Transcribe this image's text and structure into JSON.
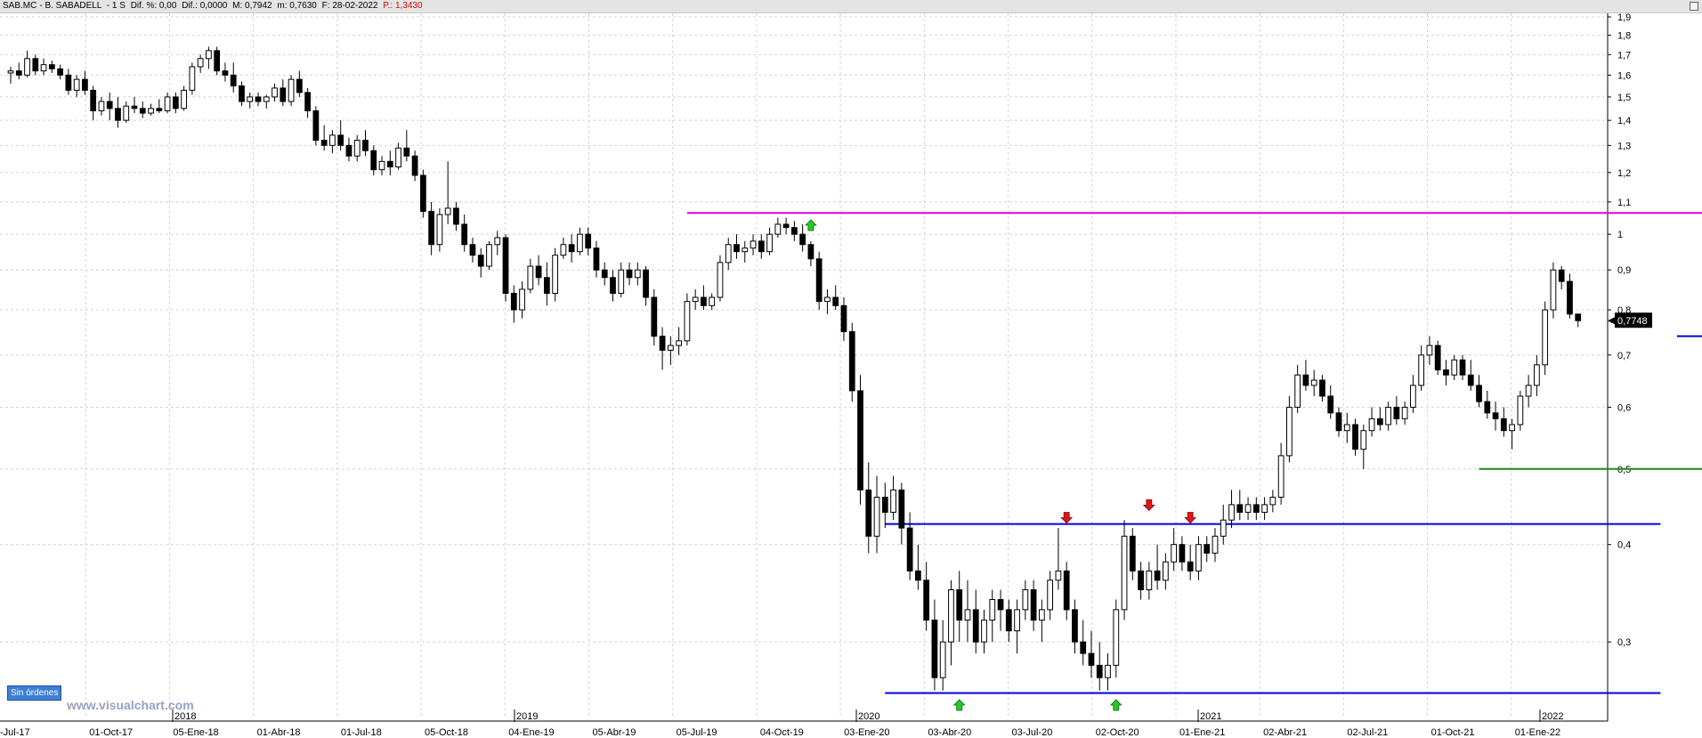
{
  "header": {
    "symbol": "SAB.MC",
    "name": "- B. SABADELL",
    "timeframe": "- 1 S",
    "dif_pct": "Dif. %: 0,00",
    "dif": "Dif.: 0,0000",
    "max": "M: 0,7942",
    "min": "m: 0,7630",
    "date": "F: 28-02-2022",
    "price": "P.: 1,3430"
  },
  "status": {
    "orders_label": "Sin órdenes"
  },
  "watermark": "www.visualchart.com",
  "colors": {
    "magenta_line": "#e000e0",
    "blue_line": "#0000e6",
    "green_line": "#1a8a1a",
    "up_arrow": "#22cc22",
    "down_arrow": "#e01515",
    "candle": "#000000",
    "grid": "#d4d4d4"
  },
  "chart_data": {
    "type": "candlestick",
    "scale": "log",
    "ylim": [
      0.24,
      1.9
    ],
    "grid": true,
    "y_ticks": [
      "1,9",
      "1,8",
      "1,7",
      "1,6",
      "1,5",
      "1,4",
      "1,3",
      "1,2",
      "1,1",
      "1",
      "0,9",
      "0,8",
      "0,7",
      "0,6",
      "0,5",
      "0,4",
      "0,3"
    ],
    "x_ticks": [
      "-Jul-17",
      "01-Oct-17",
      "05-Ene-18",
      "01-Abr-18",
      "01-Jul-18",
      "05-Oct-18",
      "04-Ene-19",
      "05-Abr-19",
      "05-Jul-19",
      "04-Oct-19",
      "03-Ene-20",
      "03-Abr-20",
      "03-Jul-20",
      "02-Oct-20",
      "01-Ene-21",
      "02-Abr-21",
      "02-Jul-21",
      "01-Oct-21",
      "01-Ene-22"
    ],
    "year_labels": [
      "2018",
      "2019",
      "2020",
      "2021",
      "2022"
    ],
    "last_price_label": "0,7748",
    "horizontal_lines": [
      {
        "color": "magenta_line",
        "value": 1.065,
        "from": 82,
        "to": 236
      },
      {
        "color": "blue_line",
        "value": 0.425,
        "from": 106,
        "to": 200
      },
      {
        "color": "blue_line",
        "value": 0.258,
        "from": 106,
        "to": 200
      },
      {
        "color": "green_line",
        "value": 0.5,
        "from": 178,
        "to": 218
      },
      {
        "color": "blue_line",
        "value": 0.74,
        "from": 202,
        "to": 240
      }
    ],
    "arrows": [
      {
        "type": "up",
        "index": 97,
        "value": 1.06
      },
      {
        "type": "down",
        "index": 128,
        "value": 0.424
      },
      {
        "type": "down",
        "index": 138,
        "value": 0.44
      },
      {
        "type": "down",
        "index": 143,
        "value": 0.424
      },
      {
        "type": "up",
        "index": 115,
        "value": 0.257
      },
      {
        "type": "up",
        "index": 134,
        "value": 0.257
      }
    ],
    "candles": [
      [
        1.61,
        1.64,
        1.56,
        1.62
      ],
      [
        1.62,
        1.66,
        1.58,
        1.6
      ],
      [
        1.6,
        1.72,
        1.59,
        1.68
      ],
      [
        1.68,
        1.7,
        1.6,
        1.62
      ],
      [
        1.62,
        1.68,
        1.6,
        1.65
      ],
      [
        1.65,
        1.67,
        1.61,
        1.63
      ],
      [
        1.63,
        1.65,
        1.58,
        1.6
      ],
      [
        1.6,
        1.63,
        1.51,
        1.53
      ],
      [
        1.53,
        1.6,
        1.5,
        1.58
      ],
      [
        1.58,
        1.62,
        1.51,
        1.53
      ],
      [
        1.53,
        1.55,
        1.4,
        1.44
      ],
      [
        1.44,
        1.5,
        1.42,
        1.48
      ],
      [
        1.48,
        1.52,
        1.4,
        1.45
      ],
      [
        1.45,
        1.5,
        1.37,
        1.4
      ],
      [
        1.4,
        1.48,
        1.39,
        1.46
      ],
      [
        1.46,
        1.5,
        1.43,
        1.45
      ],
      [
        1.45,
        1.48,
        1.41,
        1.43
      ],
      [
        1.43,
        1.47,
        1.42,
        1.45
      ],
      [
        1.45,
        1.49,
        1.43,
        1.44
      ],
      [
        1.44,
        1.52,
        1.43,
        1.5
      ],
      [
        1.5,
        1.52,
        1.43,
        1.45
      ],
      [
        1.45,
        1.55,
        1.44,
        1.53
      ],
      [
        1.53,
        1.66,
        1.51,
        1.64
      ],
      [
        1.64,
        1.7,
        1.61,
        1.68
      ],
      [
        1.68,
        1.74,
        1.63,
        1.72
      ],
      [
        1.72,
        1.74,
        1.6,
        1.62
      ],
      [
        1.62,
        1.66,
        1.57,
        1.6
      ],
      [
        1.6,
        1.66,
        1.52,
        1.55
      ],
      [
        1.55,
        1.57,
        1.46,
        1.48
      ],
      [
        1.48,
        1.52,
        1.45,
        1.5
      ],
      [
        1.5,
        1.52,
        1.46,
        1.48
      ],
      [
        1.48,
        1.51,
        1.45,
        1.5
      ],
      [
        1.5,
        1.56,
        1.48,
        1.54
      ],
      [
        1.54,
        1.58,
        1.46,
        1.48
      ],
      [
        1.48,
        1.6,
        1.46,
        1.58
      ],
      [
        1.58,
        1.62,
        1.5,
        1.52
      ],
      [
        1.52,
        1.54,
        1.41,
        1.44
      ],
      [
        1.44,
        1.46,
        1.3,
        1.32
      ],
      [
        1.32,
        1.38,
        1.28,
        1.3
      ],
      [
        1.3,
        1.36,
        1.27,
        1.34
      ],
      [
        1.34,
        1.4,
        1.28,
        1.3
      ],
      [
        1.3,
        1.33,
        1.24,
        1.26
      ],
      [
        1.26,
        1.34,
        1.24,
        1.32
      ],
      [
        1.32,
        1.36,
        1.26,
        1.28
      ],
      [
        1.28,
        1.3,
        1.19,
        1.21
      ],
      [
        1.21,
        1.26,
        1.19,
        1.24
      ],
      [
        1.24,
        1.28,
        1.19,
        1.22
      ],
      [
        1.22,
        1.31,
        1.21,
        1.29
      ],
      [
        1.29,
        1.36,
        1.24,
        1.26
      ],
      [
        1.26,
        1.28,
        1.17,
        1.19
      ],
      [
        1.19,
        1.21,
        1.05,
        1.07
      ],
      [
        1.07,
        1.1,
        0.94,
        0.97
      ],
      [
        0.97,
        1.08,
        0.95,
        1.06
      ],
      [
        1.06,
        1.24,
        1.03,
        1.08
      ],
      [
        1.08,
        1.1,
        1.01,
        1.03
      ],
      [
        1.03,
        1.06,
        0.95,
        0.97
      ],
      [
        0.97,
        0.99,
        0.92,
        0.94
      ],
      [
        0.94,
        0.96,
        0.88,
        0.91
      ],
      [
        0.91,
        0.98,
        0.9,
        0.97
      ],
      [
        0.97,
        1.01,
        0.94,
        0.99
      ],
      [
        0.99,
        1.0,
        0.82,
        0.84
      ],
      [
        0.84,
        0.86,
        0.77,
        0.8
      ],
      [
        0.8,
        0.87,
        0.78,
        0.85
      ],
      [
        0.85,
        0.93,
        0.84,
        0.91
      ],
      [
        0.91,
        0.94,
        0.86,
        0.88
      ],
      [
        0.88,
        0.92,
        0.81,
        0.84
      ],
      [
        0.84,
        0.96,
        0.82,
        0.94
      ],
      [
        0.94,
        0.99,
        0.93,
        0.97
      ],
      [
        0.97,
        1.0,
        0.92,
        0.95
      ],
      [
        0.95,
        1.02,
        0.94,
        1.0
      ],
      [
        1.0,
        1.02,
        0.94,
        0.96
      ],
      [
        0.96,
        0.98,
        0.88,
        0.9
      ],
      [
        0.9,
        0.92,
        0.86,
        0.88
      ],
      [
        0.88,
        0.9,
        0.82,
        0.84
      ],
      [
        0.84,
        0.92,
        0.83,
        0.9
      ],
      [
        0.9,
        0.92,
        0.86,
        0.88
      ],
      [
        0.88,
        0.92,
        0.86,
        0.9
      ],
      [
        0.9,
        0.91,
        0.81,
        0.83
      ],
      [
        0.83,
        0.85,
        0.72,
        0.74
      ],
      [
        0.74,
        0.76,
        0.67,
        0.71
      ],
      [
        0.71,
        0.74,
        0.68,
        0.72
      ],
      [
        0.72,
        0.76,
        0.7,
        0.73
      ],
      [
        0.73,
        0.84,
        0.72,
        0.82
      ],
      [
        0.82,
        0.85,
        0.8,
        0.83
      ],
      [
        0.83,
        0.86,
        0.8,
        0.81
      ],
      [
        0.81,
        0.84,
        0.8,
        0.83
      ],
      [
        0.83,
        0.94,
        0.82,
        0.92
      ],
      [
        0.92,
        0.99,
        0.9,
        0.97
      ],
      [
        0.97,
        1.0,
        0.93,
        0.95
      ],
      [
        0.95,
        0.98,
        0.92,
        0.96
      ],
      [
        0.96,
        1.0,
        0.94,
        0.98
      ],
      [
        0.98,
        1.0,
        0.93,
        0.95
      ],
      [
        0.95,
        1.02,
        0.94,
        1.0
      ],
      [
        1.0,
        1.05,
        0.99,
        1.03
      ],
      [
        1.03,
        1.05,
        1.0,
        1.02
      ],
      [
        1.02,
        1.04,
        0.98,
        1.0
      ],
      [
        1.0,
        1.03,
        0.95,
        0.97
      ],
      [
        0.97,
        0.98,
        0.91,
        0.93
      ],
      [
        0.93,
        0.95,
        0.8,
        0.82
      ],
      [
        0.82,
        0.85,
        0.79,
        0.83
      ],
      [
        0.83,
        0.86,
        0.8,
        0.81
      ],
      [
        0.81,
        0.83,
        0.73,
        0.75
      ],
      [
        0.75,
        0.77,
        0.61,
        0.63
      ],
      [
        0.63,
        0.66,
        0.45,
        0.47
      ],
      [
        0.47,
        0.51,
        0.39,
        0.41
      ],
      [
        0.41,
        0.49,
        0.39,
        0.46
      ],
      [
        0.46,
        0.48,
        0.42,
        0.44
      ],
      [
        0.44,
        0.49,
        0.43,
        0.47
      ],
      [
        0.47,
        0.48,
        0.4,
        0.42
      ],
      [
        0.42,
        0.44,
        0.36,
        0.37
      ],
      [
        0.37,
        0.4,
        0.35,
        0.36
      ],
      [
        0.36,
        0.38,
        0.31,
        0.32
      ],
      [
        0.32,
        0.34,
        0.26,
        0.27
      ],
      [
        0.27,
        0.32,
        0.26,
        0.3
      ],
      [
        0.3,
        0.36,
        0.28,
        0.35
      ],
      [
        0.35,
        0.37,
        0.3,
        0.32
      ],
      [
        0.32,
        0.36,
        0.3,
        0.33
      ],
      [
        0.33,
        0.35,
        0.29,
        0.3
      ],
      [
        0.3,
        0.33,
        0.29,
        0.32
      ],
      [
        0.32,
        0.35,
        0.3,
        0.34
      ],
      [
        0.34,
        0.35,
        0.31,
        0.33
      ],
      [
        0.33,
        0.34,
        0.3,
        0.31
      ],
      [
        0.31,
        0.34,
        0.29,
        0.33
      ],
      [
        0.33,
        0.36,
        0.32,
        0.35
      ],
      [
        0.35,
        0.36,
        0.31,
        0.32
      ],
      [
        0.32,
        0.34,
        0.3,
        0.33
      ],
      [
        0.33,
        0.37,
        0.32,
        0.36
      ],
      [
        0.36,
        0.42,
        0.35,
        0.37
      ],
      [
        0.37,
        0.38,
        0.32,
        0.33
      ],
      [
        0.33,
        0.34,
        0.29,
        0.3
      ],
      [
        0.3,
        0.32,
        0.28,
        0.29
      ],
      [
        0.29,
        0.31,
        0.27,
        0.28
      ],
      [
        0.28,
        0.3,
        0.26,
        0.27
      ],
      [
        0.27,
        0.29,
        0.26,
        0.28
      ],
      [
        0.28,
        0.34,
        0.27,
        0.33
      ],
      [
        0.33,
        0.43,
        0.32,
        0.41
      ],
      [
        0.41,
        0.42,
        0.36,
        0.37
      ],
      [
        0.37,
        0.38,
        0.34,
        0.35
      ],
      [
        0.35,
        0.38,
        0.34,
        0.37
      ],
      [
        0.37,
        0.4,
        0.35,
        0.36
      ],
      [
        0.36,
        0.39,
        0.35,
        0.38
      ],
      [
        0.38,
        0.42,
        0.37,
        0.4
      ],
      [
        0.4,
        0.41,
        0.37,
        0.38
      ],
      [
        0.38,
        0.4,
        0.36,
        0.37
      ],
      [
        0.37,
        0.41,
        0.36,
        0.4
      ],
      [
        0.4,
        0.41,
        0.38,
        0.39
      ],
      [
        0.39,
        0.42,
        0.38,
        0.41
      ],
      [
        0.41,
        0.45,
        0.4,
        0.43
      ],
      [
        0.43,
        0.47,
        0.42,
        0.45
      ],
      [
        0.45,
        0.47,
        0.43,
        0.44
      ],
      [
        0.44,
        0.46,
        0.43,
        0.45
      ],
      [
        0.45,
        0.46,
        0.43,
        0.44
      ],
      [
        0.44,
        0.46,
        0.43,
        0.45
      ],
      [
        0.45,
        0.47,
        0.44,
        0.46
      ],
      [
        0.46,
        0.54,
        0.45,
        0.52
      ],
      [
        0.52,
        0.62,
        0.51,
        0.6
      ],
      [
        0.6,
        0.68,
        0.59,
        0.66
      ],
      [
        0.66,
        0.69,
        0.63,
        0.64
      ],
      [
        0.64,
        0.67,
        0.62,
        0.65
      ],
      [
        0.65,
        0.66,
        0.61,
        0.62
      ],
      [
        0.62,
        0.64,
        0.58,
        0.59
      ],
      [
        0.59,
        0.6,
        0.55,
        0.56
      ],
      [
        0.56,
        0.59,
        0.54,
        0.57
      ],
      [
        0.57,
        0.58,
        0.52,
        0.53
      ],
      [
        0.53,
        0.57,
        0.5,
        0.56
      ],
      [
        0.56,
        0.6,
        0.55,
        0.58
      ],
      [
        0.58,
        0.6,
        0.56,
        0.57
      ],
      [
        0.57,
        0.61,
        0.56,
        0.6
      ],
      [
        0.6,
        0.62,
        0.57,
        0.58
      ],
      [
        0.58,
        0.61,
        0.57,
        0.6
      ],
      [
        0.6,
        0.66,
        0.59,
        0.64
      ],
      [
        0.64,
        0.72,
        0.63,
        0.7
      ],
      [
        0.7,
        0.74,
        0.68,
        0.72
      ],
      [
        0.72,
        0.73,
        0.66,
        0.67
      ],
      [
        0.67,
        0.69,
        0.64,
        0.66
      ],
      [
        0.66,
        0.7,
        0.65,
        0.69
      ],
      [
        0.69,
        0.7,
        0.65,
        0.66
      ],
      [
        0.66,
        0.69,
        0.63,
        0.64
      ],
      [
        0.64,
        0.66,
        0.6,
        0.61
      ],
      [
        0.61,
        0.63,
        0.58,
        0.59
      ],
      [
        0.59,
        0.61,
        0.56,
        0.58
      ],
      [
        0.58,
        0.6,
        0.55,
        0.56
      ],
      [
        0.56,
        0.58,
        0.53,
        0.57
      ],
      [
        0.57,
        0.63,
        0.56,
        0.62
      ],
      [
        0.62,
        0.66,
        0.6,
        0.64
      ],
      [
        0.64,
        0.7,
        0.62,
        0.68
      ],
      [
        0.68,
        0.82,
        0.66,
        0.8
      ],
      [
        0.8,
        0.92,
        0.78,
        0.9
      ],
      [
        0.9,
        0.91,
        0.85,
        0.87
      ],
      [
        0.87,
        0.89,
        0.78,
        0.79
      ],
      [
        0.79,
        0.79,
        0.76,
        0.7748
      ]
    ]
  }
}
